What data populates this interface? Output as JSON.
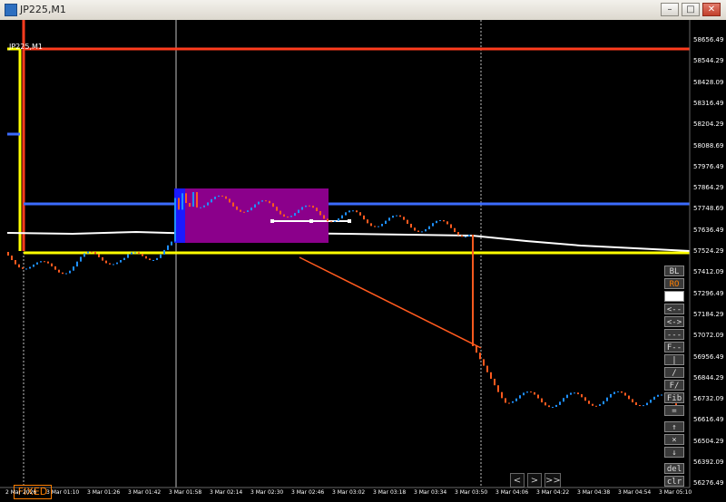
{
  "window": {
    "title": "JP225,M1"
  },
  "chart": {
    "symbol_label": "JP225,M1",
    "fixed_label": "FIXED"
  },
  "price_labels": [
    "58656.49",
    "58544.29",
    "58428.09",
    "58316.49",
    "58204.29",
    "58088.69",
    "57976.49",
    "57864.29",
    "57748.69",
    "57636.49",
    "57524.29",
    "57412.09",
    "57296.49",
    "57184.29",
    "57072.09",
    "56956.49",
    "56844.29",
    "56732.09",
    "56616.49",
    "56504.29",
    "56392.09",
    "56276.49"
  ],
  "time_labels": [
    "2 Mar 2026",
    "3 Mar 01:10",
    "3 Mar 01:26",
    "3 Mar 01:42",
    "3 Mar 01:58",
    "3 Mar 02:14",
    "3 Mar 02:30",
    "3 Mar 02:46",
    "3 Mar 03:02",
    "3 Mar 03:18",
    "3 Mar 03:34",
    "3 Mar 03:50",
    "3 Mar 04:06",
    "3 Mar 04:22",
    "3 Mar 04:38",
    "3 Mar 04:54",
    "3 Mar 05:10"
  ],
  "tools": {
    "bl": "BL",
    "ro": "RO",
    "blank": "",
    "dash1": "<--",
    "dash2": "<->",
    "dash3": "---",
    "f_dash": "F--",
    "pipe": "|",
    "slash": "/",
    "f_slash": "F/",
    "fib": "Fib",
    "equal": "=",
    "up": "↑",
    "x": "×",
    "down": "↓",
    "del": "del",
    "clr": "clr"
  },
  "nav": {
    "prev": "<",
    "next": ">",
    "end": ">>"
  }
}
